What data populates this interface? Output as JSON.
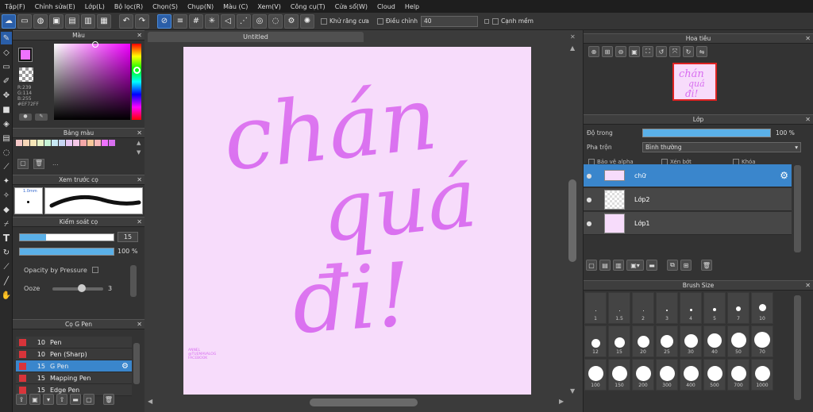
{
  "menu": [
    "Tập(F)",
    "Chỉnh sửa(E)",
    "Lớp(L)",
    "Bộ lọc(R)",
    "Chọn(S)",
    "Chụp(N)",
    "Màu (C)",
    "Xem(V)",
    "Công cụ(T)",
    "Cửa sổ(W)",
    "Cloud",
    "Help"
  ],
  "toolbar": {
    "snap_off_label": "Khử răng cưa",
    "correction_label": "Điều chỉnh",
    "correction_value": "40",
    "antialias_label": "Cạnh mềm"
  },
  "color_panel": {
    "title": "Màu",
    "r": "R:239",
    "g": "G:114",
    "b": "B:255",
    "hex": "#EF72FF"
  },
  "palette_panel": {
    "title": "Bảng màu",
    "colors": [
      "#f4c7c7",
      "#f7d6b8",
      "#f7e7b8",
      "#e8f4c7",
      "#c7f4d6",
      "#c7e8f4",
      "#c7d6f4",
      "#e7c7f4",
      "#f4c7e7",
      "#f4a8a8",
      "#f7c79a",
      "#f7b8b8",
      "#ef72ff",
      "#d86ff0"
    ],
    "dots": "..."
  },
  "brush_preview": {
    "title": "Xem trước cọ",
    "size_label": "1.0mm"
  },
  "brush_control": {
    "title": "Kiểm soát cọ",
    "size_value": "15",
    "opacity_value": "100 %",
    "opacity_pressure_label": "Opacity by Pressure",
    "ooze_label": "Ooze",
    "ooze_value": "3"
  },
  "pen_panel": {
    "title": "Cọ G Pen",
    "items": [
      {
        "size": "10",
        "name": "Pen",
        "color": "#d8343a"
      },
      {
        "size": "10",
        "name": "Pen (Sharp)",
        "color": "#d8343a"
      },
      {
        "size": "15",
        "name": "G Pen",
        "color": "#d8343a"
      },
      {
        "size": "15",
        "name": "Mapping Pen",
        "color": "#d8343a"
      },
      {
        "size": "15",
        "name": "Edge Pen",
        "color": "#d8343a"
      }
    ]
  },
  "canvas": {
    "tab_title": "Untitled",
    "lettering_line1": "chán",
    "lettering_line2": "quá",
    "lettering_line3": "đi!",
    "credit": "ANNEL\n@TUEMAVALOG\nFACEBOOK"
  },
  "navigator": {
    "title": "Hoa tiêu"
  },
  "layers_panel": {
    "title": "Lớp",
    "opacity_label": "Độ trong",
    "opacity_value": "100 %",
    "blend_label": "Pha trộn",
    "blend_value": "Bình thường",
    "protect_alpha": "Bảo vệ alpha",
    "clipping": "Xén bớt",
    "lock": "Khóa",
    "layers": [
      {
        "name": "chữ"
      },
      {
        "name": "Lớp2"
      },
      {
        "name": "Lớp1"
      }
    ]
  },
  "brush_size_panel": {
    "title": "Brush Size",
    "row1": [
      "1",
      "1.5",
      "2",
      "3",
      "4",
      "5",
      "7",
      "10"
    ],
    "row2": [
      "12",
      "15",
      "20",
      "25",
      "30",
      "40",
      "50",
      "70"
    ],
    "row3": [
      "100",
      "150",
      "200",
      "300",
      "400",
      "500",
      "700",
      "1000"
    ]
  }
}
